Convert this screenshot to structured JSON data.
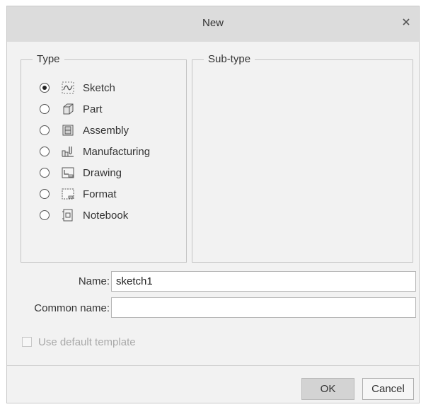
{
  "dialog": {
    "title": "New",
    "close_icon": "close-icon"
  },
  "type_group": {
    "legend": "Type",
    "options": [
      {
        "label": "Sketch",
        "icon": "sketch-icon",
        "selected": true
      },
      {
        "label": "Part",
        "icon": "part-icon",
        "selected": false
      },
      {
        "label": "Assembly",
        "icon": "assembly-icon",
        "selected": false
      },
      {
        "label": "Manufacturing",
        "icon": "manufacturing-icon",
        "selected": false
      },
      {
        "label": "Drawing",
        "icon": "drawing-icon",
        "selected": false
      },
      {
        "label": "Format",
        "icon": "format-icon",
        "selected": false
      },
      {
        "label": "Notebook",
        "icon": "notebook-icon",
        "selected": false
      }
    ]
  },
  "subtype_group": {
    "legend": "Sub-type"
  },
  "form": {
    "name_label": "Name:",
    "name_value": "sketch1",
    "common_name_label": "Common name:",
    "common_name_value": ""
  },
  "template": {
    "label": "Use default template",
    "checked": false,
    "enabled": false
  },
  "buttons": {
    "ok": "OK",
    "cancel": "Cancel"
  }
}
